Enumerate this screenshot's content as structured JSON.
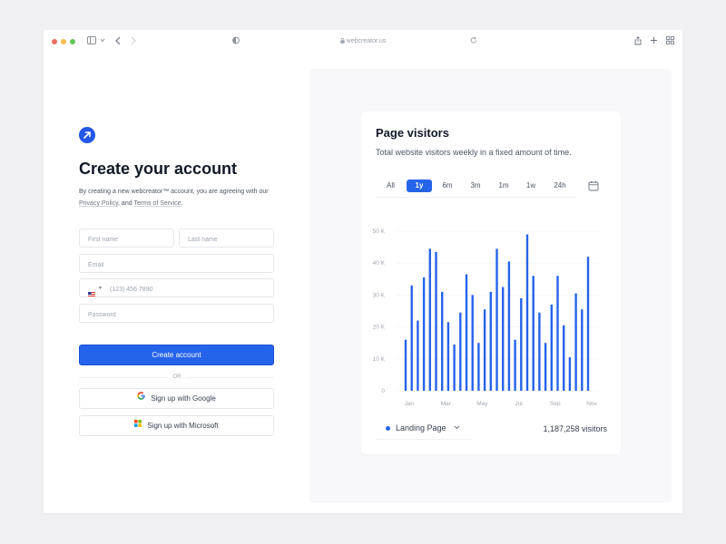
{
  "browser": {
    "url": "webcreator.us",
    "icons": [
      "sidebar-icon",
      "chevron-down-icon",
      "back-icon",
      "forward-icon",
      "shield-icon",
      "lock-icon",
      "reload-icon",
      "share-icon",
      "plus-icon",
      "tabs-grid-icon"
    ]
  },
  "colors": {
    "accent": "#2563eb",
    "text": "#111827",
    "muted": "#6b7280"
  },
  "signup": {
    "title": "Create your account",
    "desc_prefix": "By creating a new webcreator™ account, you are agreeing with our ",
    "privacy_link": "Privacy Policy",
    "desc_middle": ", and ",
    "terms_link": "Terms of Service",
    "desc_suffix": ".",
    "first_name_placeholder": "First name",
    "last_name_placeholder": "Last name",
    "email_placeholder": "Email",
    "phone_placeholder": "(123) 456 7890",
    "password_placeholder": "Password",
    "create_button": "Create account",
    "or_label": "OR",
    "google_button": "Sign up with Google",
    "microsoft_button": "Sign up with Microsoft"
  },
  "visitors_card": {
    "title": "Page visitors",
    "subtitle": "Total website visitors weekly in a fixed amount of time.",
    "tabs": [
      "All",
      "1y",
      "6m",
      "3m",
      "1m",
      "1w",
      "24h"
    ],
    "active_tab": "1y",
    "legend_label": "Landing Page",
    "total": "1,187,258 visitors"
  },
  "chart_data": {
    "type": "bar",
    "series": [
      {
        "name": "Landing Page",
        "values": [
          16000,
          33000,
          22000,
          35500,
          44500,
          43500,
          31000,
          21500,
          14500,
          24500,
          36500,
          30000,
          15000,
          25500,
          31000,
          44500,
          32500,
          40500,
          16000,
          29000,
          49000,
          36000,
          24500,
          15000,
          27000,
          36000,
          20500,
          10500,
          30500,
          25500,
          42000
        ]
      }
    ],
    "x_tick_labels": [
      "Jan",
      "Mar",
      "May",
      "Jul",
      "Sep",
      "Nov"
    ],
    "y_tick_labels": [
      "0",
      "10 K",
      "20 K",
      "30 K",
      "40 K",
      "50 K"
    ],
    "ylim": [
      0,
      50000
    ],
    "grid": true,
    "color": "#2563eb"
  }
}
